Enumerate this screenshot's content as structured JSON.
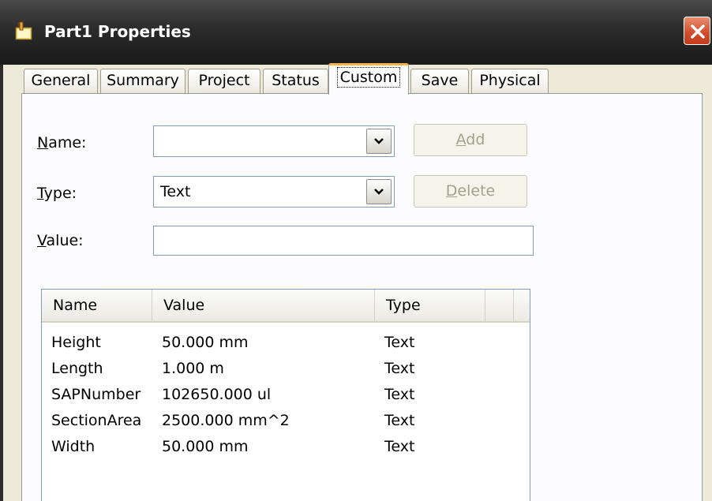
{
  "window": {
    "title": "Part1 Properties",
    "icon": "part-document-icon",
    "close_icon": "close-icon"
  },
  "tabs": [
    {
      "label": "General",
      "active": false
    },
    {
      "label": "Summary",
      "active": false
    },
    {
      "label": "Project",
      "active": false
    },
    {
      "label": "Status",
      "active": false
    },
    {
      "label": "Custom",
      "active": true
    },
    {
      "label": "Save",
      "active": false
    },
    {
      "label": "Physical",
      "active": false
    }
  ],
  "form": {
    "name": {
      "label_first": "N",
      "label_rest": "ame:",
      "value": ""
    },
    "type": {
      "label_first": "T",
      "label_rest": "ype:",
      "value": "Text"
    },
    "value": {
      "label_first": "V",
      "label_rest": "alue:",
      "value": ""
    },
    "add_button": {
      "label_first": "A",
      "label_rest": "dd",
      "enabled": false
    },
    "delete_button": {
      "label_first": "D",
      "label_rest": "elete",
      "enabled": false
    }
  },
  "properties_list": {
    "columns": [
      "Name",
      "Value",
      "Type"
    ],
    "rows": [
      {
        "name": "Height",
        "value": "50.000 mm",
        "type": "Text"
      },
      {
        "name": "Length",
        "value": "1.000 m",
        "type": "Text"
      },
      {
        "name": "SAPNumber",
        "value": "102650.000 ul",
        "type": "Text"
      },
      {
        "name": "SectionArea",
        "value": "2500.000 mm^2",
        "type": "Text"
      },
      {
        "name": "Width",
        "value": "50.000 mm",
        "type": "Text"
      }
    ]
  },
  "colors": {
    "title_bar": "#2b2b2b",
    "active_tab_accent": "#f6b44b",
    "close_button": "#d4502d",
    "dialog_background": "#ece9d8"
  }
}
